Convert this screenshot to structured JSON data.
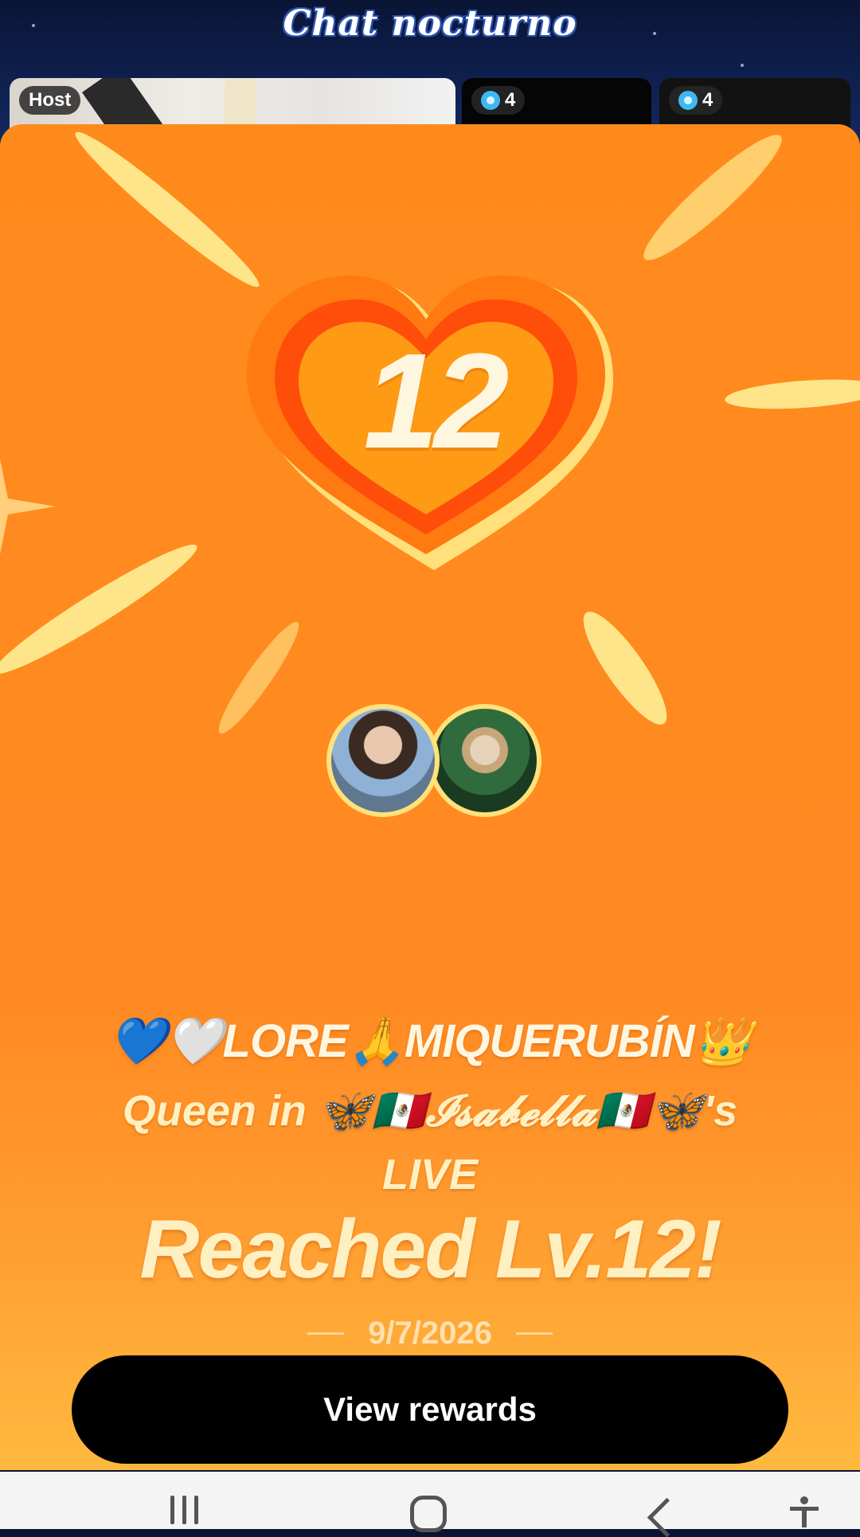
{
  "room": {
    "title": "Chat nocturno"
  },
  "guests": [
    {
      "tag": "Host"
    },
    {
      "count": "4"
    },
    {
      "count": "4"
    }
  ],
  "level_card": {
    "level_number": "12",
    "name": "💙🤍LORE🙏MIQUERUBÍN👑",
    "queen_line": "Queen in 🦋🇲🇽𝓘𝓼𝓪𝓫𝓮𝓵𝓵𝓪🇲🇽🦋's",
    "live_word": "LIVE",
    "headline": "Reached Lv.12!",
    "date": "9/7/2026",
    "cta_label": "View rewards"
  },
  "colors": {
    "card_orange": "#ff8a1c",
    "accent_yellow": "#ffe58a",
    "cta_black": "#000000"
  },
  "icons": [
    "gem-icon",
    "heart-icon",
    "sparkle-icon",
    "recents-icon",
    "home-icon",
    "back-icon",
    "accessibility-icon"
  ]
}
